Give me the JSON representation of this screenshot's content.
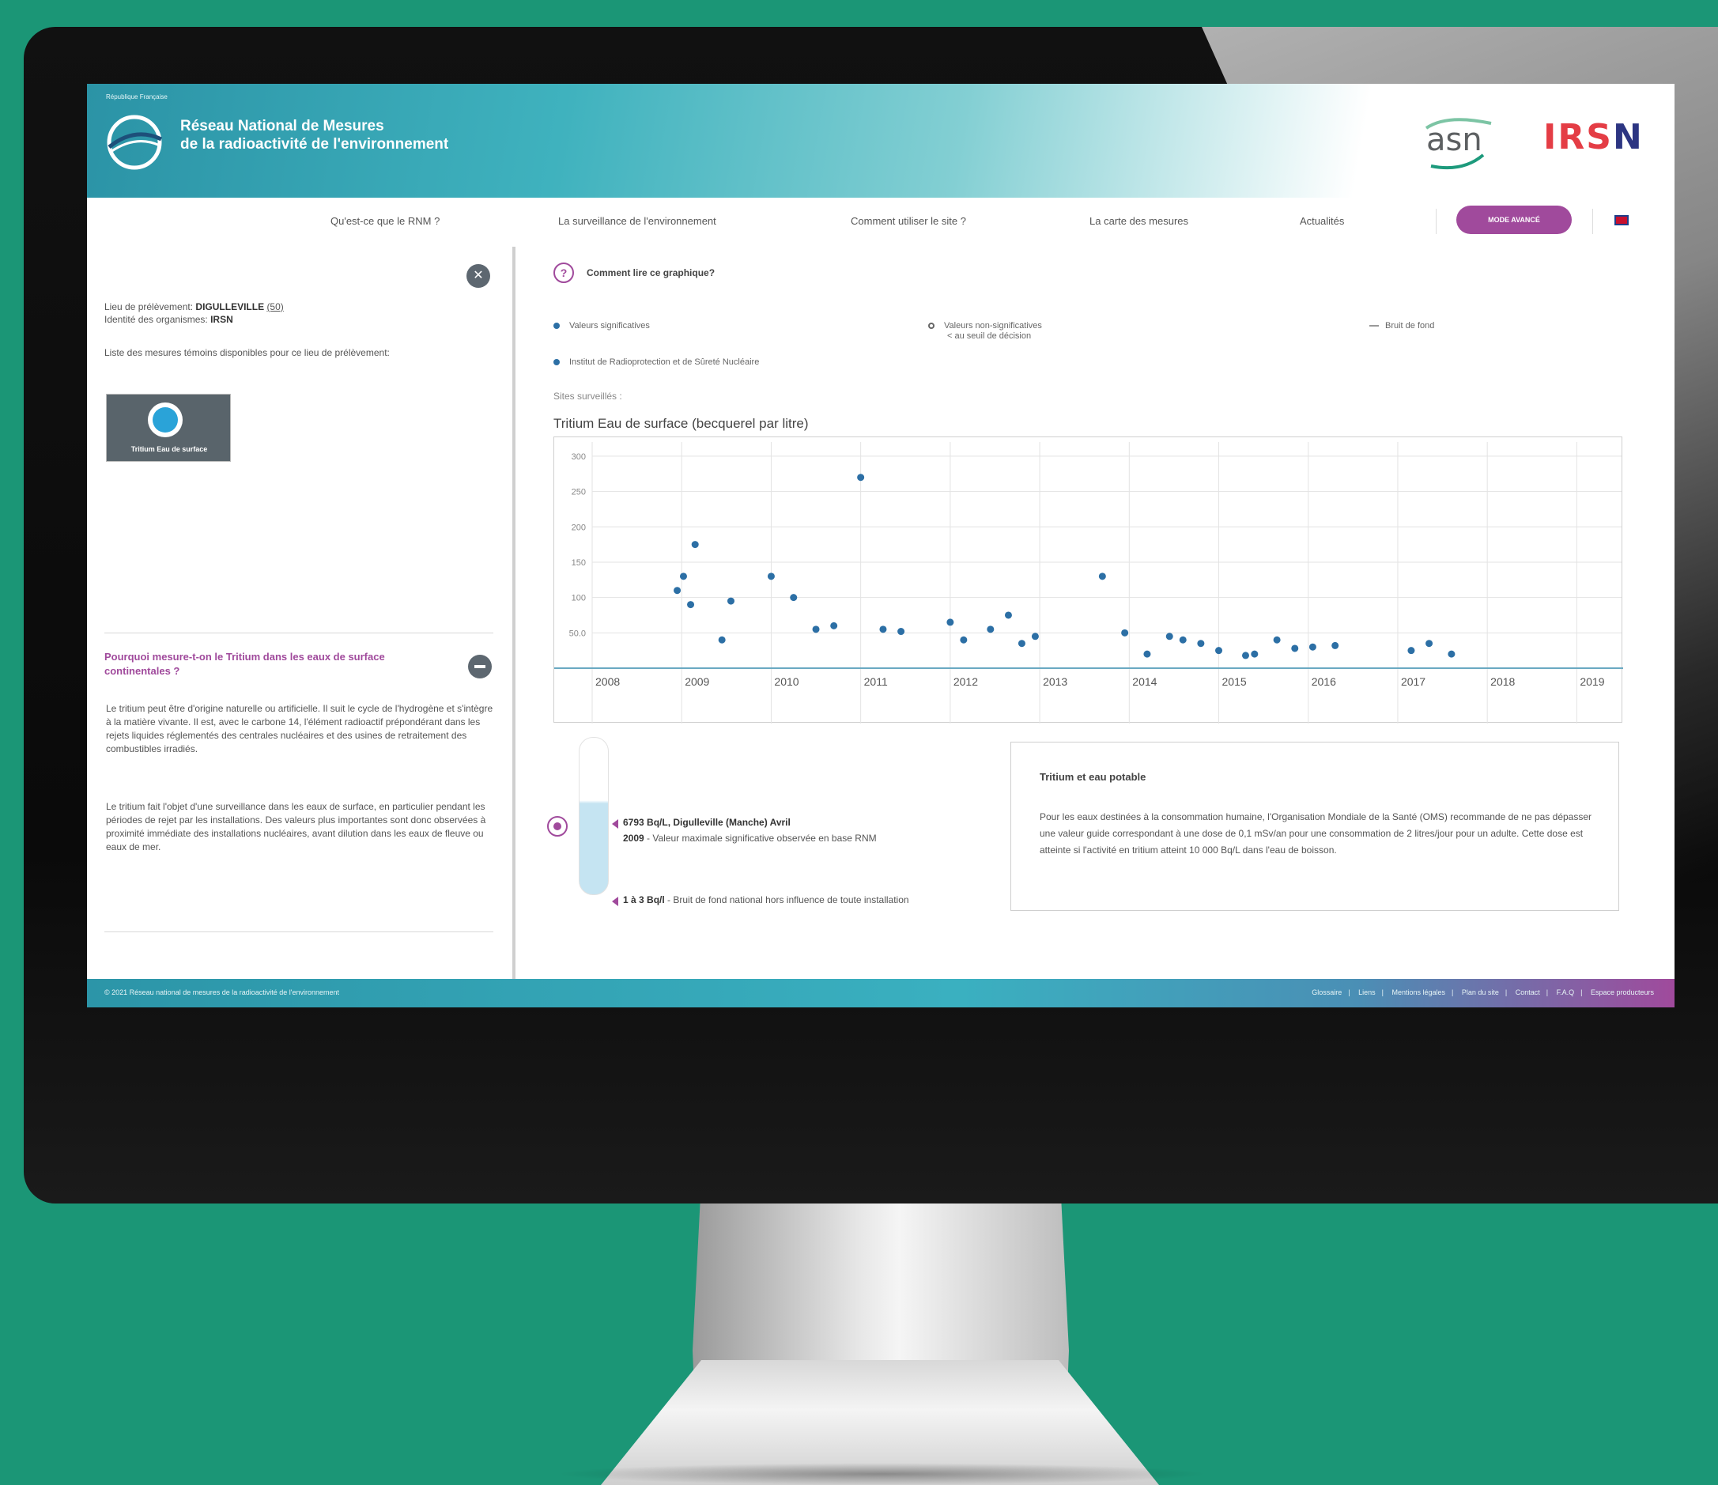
{
  "header": {
    "tiny_label": "République Française",
    "title_line1": "Réseau National de Mesures",
    "title_line2": "de la radioactivité de l'environnement",
    "logo_asn": "asn",
    "logo_irsn_main": "IRS",
    "logo_irsn_last": "N"
  },
  "nav": {
    "items": [
      "Qu'est-ce que le RNM ?",
      "La surveillance de l'environnement",
      "Comment utiliser le site ?",
      "La carte des mesures",
      "Actualités"
    ],
    "mode_button": "MODE AVANCÉ"
  },
  "left": {
    "lieu_label": "Lieu de prélèvement:",
    "lieu_value": "DIGULLEVILLE",
    "lieu_code": "(50)",
    "identite_label": "Identité des organismes:",
    "identite_value": "IRSN",
    "liste_text": "Liste des mesures témoins disponibles pour ce lieu de prélèvement:",
    "card_label": "Tritium Eau de surface",
    "why_title": "Pourquoi mesure-t-on le Tritium dans les eaux de surface continentales ?",
    "why_p1": "Le tritium peut être d'origine naturelle ou artificielle. Il suit le cycle de l'hydrogène et s'intègre à la matière vivante. Il est, avec le carbone 14, l'élément radioactif prépondérant dans les rejets liquides réglementés des centrales nucléaires et des usines de retraitement des combustibles irradiés.",
    "why_p2": "Le tritium fait l'objet d'une surveillance dans les eaux de surface, en particulier pendant les périodes de rejet par les installations. Des valeurs plus importantes sont donc observées à proximité immédiate des installations nucléaires, avant dilution dans les eaux de fleuve ou eaux de mer."
  },
  "main": {
    "how_to_read": "Comment lire ce graphique?",
    "legend": {
      "significant": "Valeurs significatives",
      "non_significant_1": "Valeurs non-significatives",
      "non_significant_2": "< au seuil de décision",
      "background": "Bruit de fond",
      "institute": "Institut de Radioprotection et de Sûreté Nucléaire"
    },
    "sites": "Sites surveillés :",
    "chart_title": "Tritium Eau de surface (becquerel par litre)"
  },
  "chart_data": {
    "type": "scatter",
    "title": "Tritium Eau de surface (becquerel par litre)",
    "xlabel": "",
    "ylabel": "",
    "x_ticks": [
      "2008",
      "2009",
      "2010",
      "2011",
      "2012",
      "2013",
      "2014",
      "2015",
      "2016",
      "2017",
      "2018",
      "2019"
    ],
    "y_ticks": [
      "50.0",
      "100",
      "150",
      "200",
      "250",
      "300"
    ],
    "xlim": [
      2008,
      2019.5
    ],
    "ylim": [
      0,
      320
    ],
    "grid": true,
    "series": [
      {
        "color": "#2c6fa5",
        "points": [
          [
            2008.95,
            110
          ],
          [
            2009.02,
            130
          ],
          [
            2009.1,
            90
          ],
          [
            2009.15,
            175
          ],
          [
            2009.45,
            40
          ],
          [
            2009.55,
            95
          ],
          [
            2010.0,
            130
          ],
          [
            2010.25,
            100
          ],
          [
            2010.5,
            55
          ],
          [
            2010.7,
            60
          ],
          [
            2011.0,
            270
          ],
          [
            2011.25,
            55
          ],
          [
            2011.45,
            52
          ],
          [
            2012.0,
            65
          ],
          [
            2012.15,
            40
          ],
          [
            2012.45,
            55
          ],
          [
            2012.65,
            75
          ],
          [
            2012.8,
            35
          ],
          [
            2012.95,
            45
          ],
          [
            2013.7,
            130
          ],
          [
            2013.95,
            50
          ],
          [
            2014.2,
            20
          ],
          [
            2014.45,
            45
          ],
          [
            2014.6,
            40
          ],
          [
            2014.8,
            35
          ],
          [
            2015.0,
            25
          ],
          [
            2015.3,
            18
          ],
          [
            2015.4,
            20
          ],
          [
            2015.65,
            40
          ],
          [
            2015.85,
            28
          ],
          [
            2016.05,
            30
          ],
          [
            2016.3,
            32
          ],
          [
            2017.15,
            25
          ],
          [
            2017.35,
            35
          ],
          [
            2017.6,
            20
          ]
        ]
      }
    ]
  },
  "info": {
    "max_bold": "6793 Bq/L, Digulleville (Manche) Avril",
    "max_year": "2009",
    "max_text": "Valeur maximale significative observée en base RNM",
    "bg_bold": "1 à 3 Bq/l",
    "bg_text": "Bruit de fond national hors influence de toute installation",
    "drink_title": "Tritium et eau potable",
    "drink_text": "Pour les eaux destinées à la consommation humaine, l'Organisation Mondiale de la Santé (OMS) recommande de ne pas dépasser une valeur guide correspondant à une dose de 0,1 mSv/an pour une consommation de 2 litres/jour pour un adulte. Cette dose est atteinte si l'activité en tritium atteint 10 000 Bq/L dans l'eau de boisson."
  },
  "footer": {
    "copyright": "© 2021 Réseau national de mesures de la radioactivité de l'environnement",
    "links": [
      "Glossaire",
      "Liens",
      "Mentions légales",
      "Plan du site",
      "Contact",
      "F.A.Q",
      "Espace producteurs"
    ]
  },
  "colors": {
    "accent": "#a04a9c",
    "teal": "#3fb2be",
    "point": "#2c6fa5"
  }
}
